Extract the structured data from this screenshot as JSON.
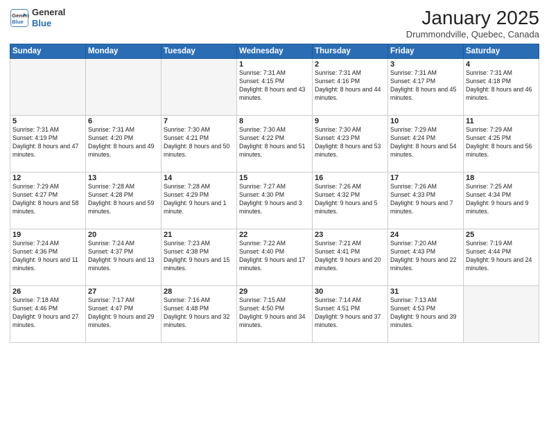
{
  "header": {
    "logo_general": "General",
    "logo_blue": "Blue",
    "month_title": "January 2025",
    "location": "Drummondville, Quebec, Canada"
  },
  "weekdays": [
    "Sunday",
    "Monday",
    "Tuesday",
    "Wednesday",
    "Thursday",
    "Friday",
    "Saturday"
  ],
  "weeks": [
    [
      {
        "day": "",
        "text": ""
      },
      {
        "day": "",
        "text": ""
      },
      {
        "day": "",
        "text": ""
      },
      {
        "day": "1",
        "text": "Sunrise: 7:31 AM\nSunset: 4:15 PM\nDaylight: 8 hours and 43 minutes."
      },
      {
        "day": "2",
        "text": "Sunrise: 7:31 AM\nSunset: 4:16 PM\nDaylight: 8 hours and 44 minutes."
      },
      {
        "day": "3",
        "text": "Sunrise: 7:31 AM\nSunset: 4:17 PM\nDaylight: 8 hours and 45 minutes."
      },
      {
        "day": "4",
        "text": "Sunrise: 7:31 AM\nSunset: 4:18 PM\nDaylight: 8 hours and 46 minutes."
      }
    ],
    [
      {
        "day": "5",
        "text": "Sunrise: 7:31 AM\nSunset: 4:19 PM\nDaylight: 8 hours and 47 minutes."
      },
      {
        "day": "6",
        "text": "Sunrise: 7:31 AM\nSunset: 4:20 PM\nDaylight: 8 hours and 49 minutes."
      },
      {
        "day": "7",
        "text": "Sunrise: 7:30 AM\nSunset: 4:21 PM\nDaylight: 8 hours and 50 minutes."
      },
      {
        "day": "8",
        "text": "Sunrise: 7:30 AM\nSunset: 4:22 PM\nDaylight: 8 hours and 51 minutes."
      },
      {
        "day": "9",
        "text": "Sunrise: 7:30 AM\nSunset: 4:23 PM\nDaylight: 8 hours and 53 minutes."
      },
      {
        "day": "10",
        "text": "Sunrise: 7:29 AM\nSunset: 4:24 PM\nDaylight: 8 hours and 54 minutes."
      },
      {
        "day": "11",
        "text": "Sunrise: 7:29 AM\nSunset: 4:25 PM\nDaylight: 8 hours and 56 minutes."
      }
    ],
    [
      {
        "day": "12",
        "text": "Sunrise: 7:29 AM\nSunset: 4:27 PM\nDaylight: 8 hours and 58 minutes."
      },
      {
        "day": "13",
        "text": "Sunrise: 7:28 AM\nSunset: 4:28 PM\nDaylight: 8 hours and 59 minutes."
      },
      {
        "day": "14",
        "text": "Sunrise: 7:28 AM\nSunset: 4:29 PM\nDaylight: 9 hours and 1 minute."
      },
      {
        "day": "15",
        "text": "Sunrise: 7:27 AM\nSunset: 4:30 PM\nDaylight: 9 hours and 3 minutes."
      },
      {
        "day": "16",
        "text": "Sunrise: 7:26 AM\nSunset: 4:32 PM\nDaylight: 9 hours and 5 minutes."
      },
      {
        "day": "17",
        "text": "Sunrise: 7:26 AM\nSunset: 4:33 PM\nDaylight: 9 hours and 7 minutes."
      },
      {
        "day": "18",
        "text": "Sunrise: 7:25 AM\nSunset: 4:34 PM\nDaylight: 9 hours and 9 minutes."
      }
    ],
    [
      {
        "day": "19",
        "text": "Sunrise: 7:24 AM\nSunset: 4:36 PM\nDaylight: 9 hours and 11 minutes."
      },
      {
        "day": "20",
        "text": "Sunrise: 7:24 AM\nSunset: 4:37 PM\nDaylight: 9 hours and 13 minutes."
      },
      {
        "day": "21",
        "text": "Sunrise: 7:23 AM\nSunset: 4:38 PM\nDaylight: 9 hours and 15 minutes."
      },
      {
        "day": "22",
        "text": "Sunrise: 7:22 AM\nSunset: 4:40 PM\nDaylight: 9 hours and 17 minutes."
      },
      {
        "day": "23",
        "text": "Sunrise: 7:21 AM\nSunset: 4:41 PM\nDaylight: 9 hours and 20 minutes."
      },
      {
        "day": "24",
        "text": "Sunrise: 7:20 AM\nSunset: 4:43 PM\nDaylight: 9 hours and 22 minutes."
      },
      {
        "day": "25",
        "text": "Sunrise: 7:19 AM\nSunset: 4:44 PM\nDaylight: 9 hours and 24 minutes."
      }
    ],
    [
      {
        "day": "26",
        "text": "Sunrise: 7:18 AM\nSunset: 4:46 PM\nDaylight: 9 hours and 27 minutes."
      },
      {
        "day": "27",
        "text": "Sunrise: 7:17 AM\nSunset: 4:47 PM\nDaylight: 9 hours and 29 minutes."
      },
      {
        "day": "28",
        "text": "Sunrise: 7:16 AM\nSunset: 4:48 PM\nDaylight: 9 hours and 32 minutes."
      },
      {
        "day": "29",
        "text": "Sunrise: 7:15 AM\nSunset: 4:50 PM\nDaylight: 9 hours and 34 minutes."
      },
      {
        "day": "30",
        "text": "Sunrise: 7:14 AM\nSunset: 4:51 PM\nDaylight: 9 hours and 37 minutes."
      },
      {
        "day": "31",
        "text": "Sunrise: 7:13 AM\nSunset: 4:53 PM\nDaylight: 9 hours and 39 minutes."
      },
      {
        "day": "",
        "text": ""
      }
    ]
  ]
}
